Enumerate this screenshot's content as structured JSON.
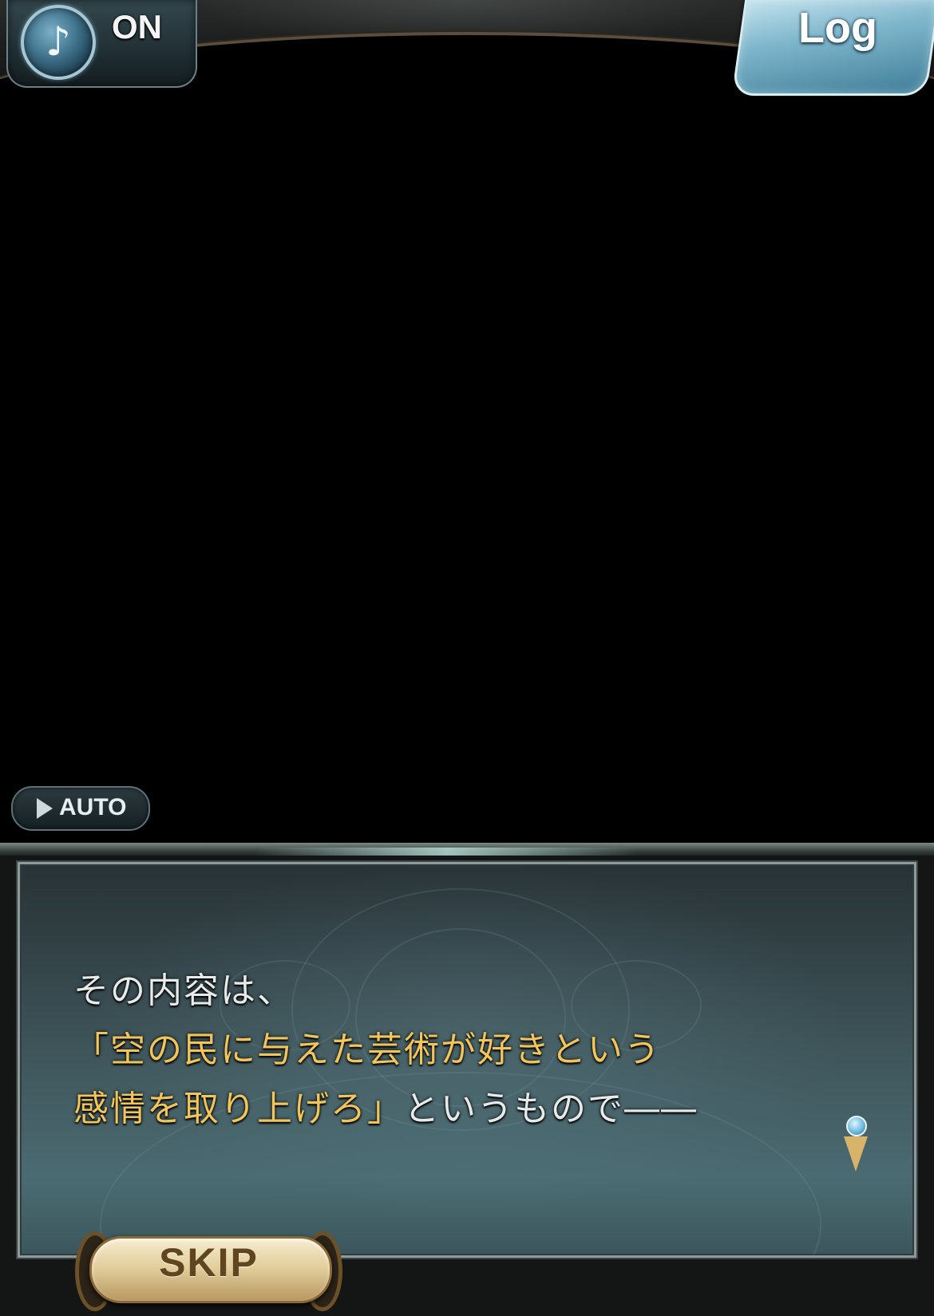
{
  "top_bar": {
    "music_toggle": {
      "icon": "music-note-icon",
      "glyph": "♪",
      "state_label": "ON"
    },
    "log_button": {
      "label": "Log"
    }
  },
  "controls": {
    "auto_button": {
      "icon": "play-triangle-icon",
      "label": "AUTO"
    },
    "skip_button": {
      "label": "SKIP"
    }
  },
  "dialogue": {
    "lines": [
      {
        "text": "その内容は、",
        "color": "#e8eaea"
      },
      {
        "text": "「空の民に与えた芸術が好きという",
        "color": "#f1c55a"
      },
      {
        "segments": [
          {
            "text": "感情を取り上げろ」",
            "color": "#f1c55a"
          },
          {
            "text": "というもので――",
            "color": "#e8eaea"
          }
        ]
      }
    ],
    "next_indicator_icon": "advance-pen-icon"
  },
  "colors": {
    "highlight_text": "#f1c55a",
    "normal_text": "#e8eaea",
    "frame": "#8e9a9a"
  }
}
